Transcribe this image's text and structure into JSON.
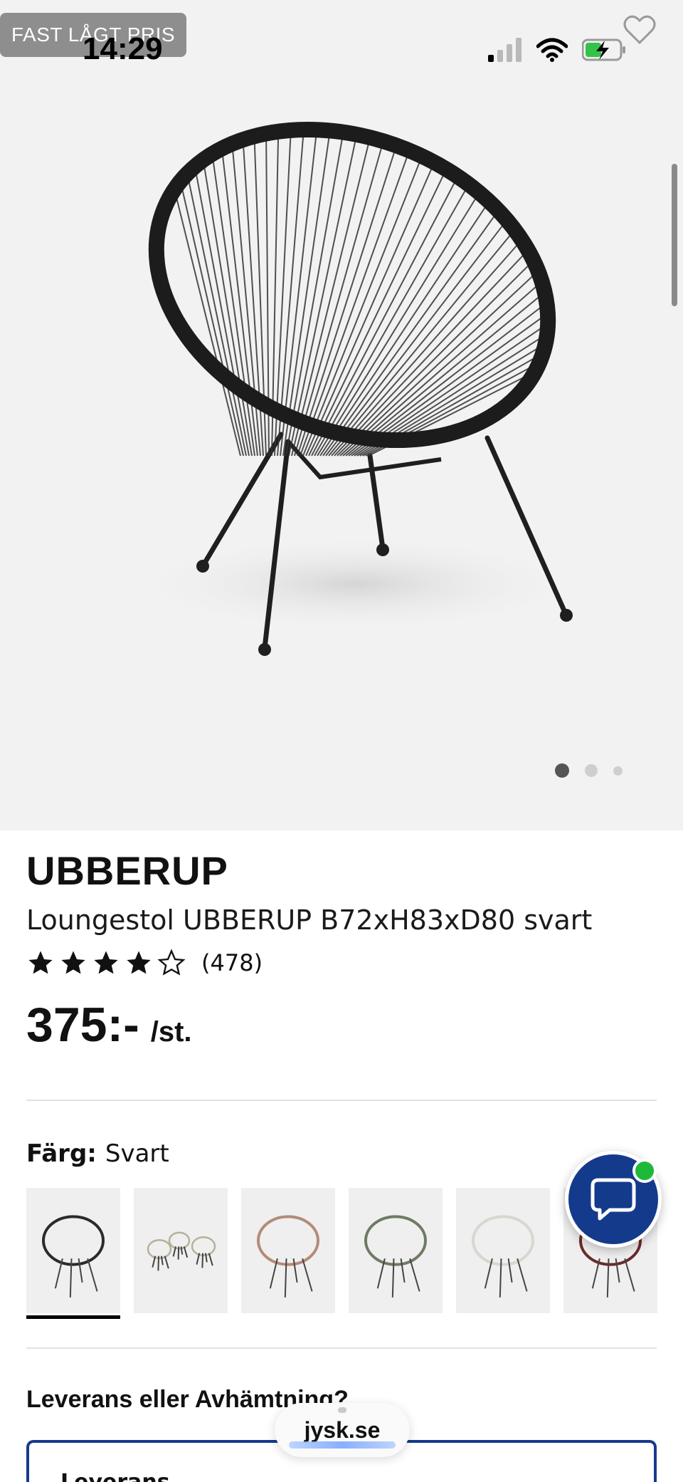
{
  "status_bar": {
    "time": "14:29"
  },
  "hero": {
    "badge": "FAST LÅGT PRIS",
    "favorite_icon": "heart-outline-icon",
    "carousel": {
      "total": 3,
      "active_index": 0
    }
  },
  "product": {
    "brand": "UBBERUP",
    "name": "Loungestol UBBERUP B72xH83xD80 svart",
    "rating": {
      "stars": 4,
      "max": 5,
      "count": "(478)"
    },
    "price": "375:-",
    "price_unit": "/st."
  },
  "color": {
    "label": "Färg:",
    "value": "Svart",
    "swatches": [
      {
        "id": "black",
        "stroke": "#2a2a2a",
        "selected": true
      },
      {
        "id": "set",
        "stroke": "#b8b09a",
        "selected": false
      },
      {
        "id": "rose",
        "stroke": "#b48a78",
        "selected": false
      },
      {
        "id": "green",
        "stroke": "#6f7a63",
        "selected": false
      },
      {
        "id": "white",
        "stroke": "#d8d6cf",
        "selected": false
      },
      {
        "id": "red",
        "stroke": "#6a2a2a",
        "selected": false
      }
    ]
  },
  "delivery": {
    "title": "Leverans eller Avhämtning?",
    "option_label": "Leverans"
  },
  "browser": {
    "url": "jysk.se"
  },
  "colors": {
    "brand_blue": "#143a8c",
    "online_green": "#1fb93a"
  }
}
